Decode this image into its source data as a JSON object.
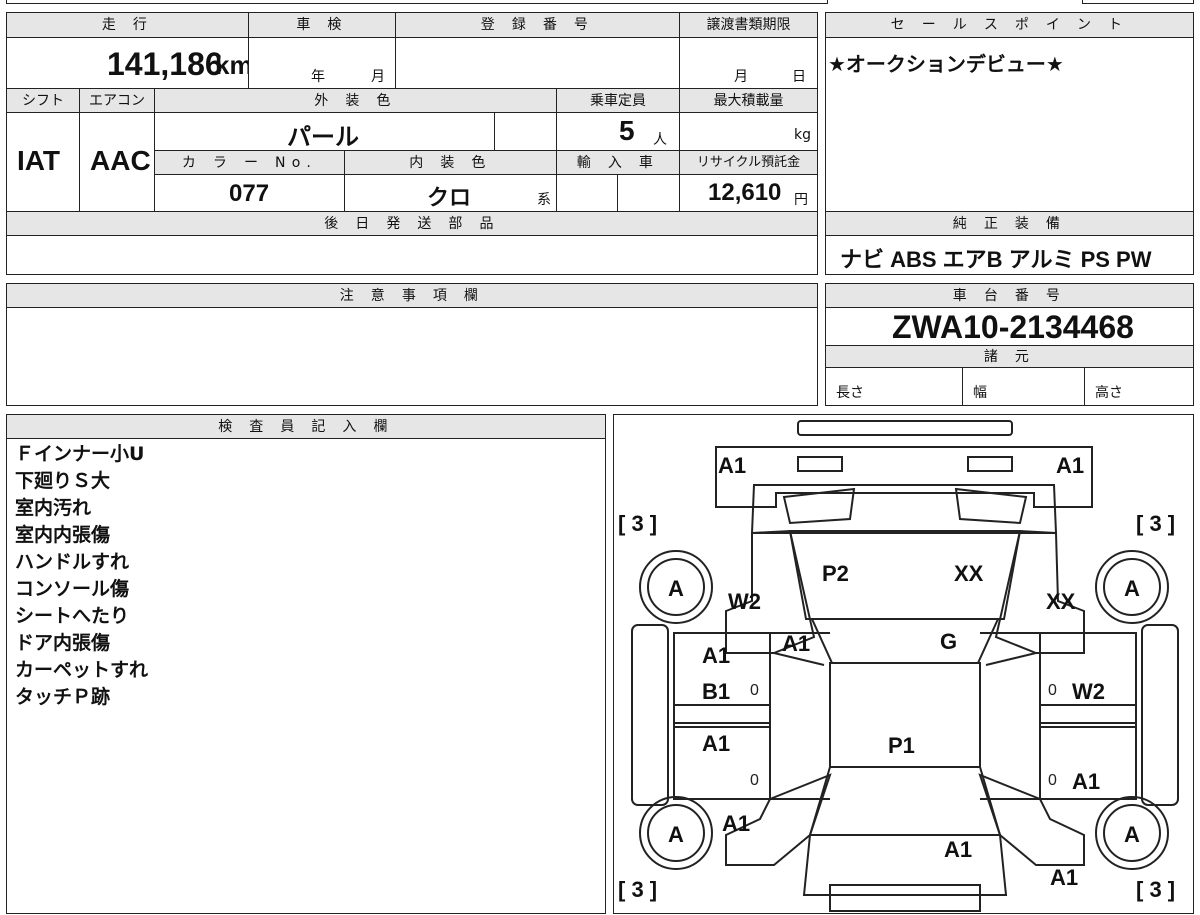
{
  "header_labels": {
    "mileage": "走 行",
    "inspection": "車 検",
    "registration": "登 録 番 号",
    "transfer_deadline": "譲渡書類期限",
    "shift": "シフト",
    "aircon": "エアコン",
    "exterior_color": "外 装 色",
    "capacity": "乗車定員",
    "max_load": "最大積載量",
    "color_no": "カ ラ ー No.",
    "interior_color": "内 装 色",
    "import": "輸 入 車",
    "recycle": "リサイクル預託金",
    "later_parts": "後 日 発 送 部 品",
    "notes": "注 意 事 項 欄",
    "sales_point": "セ ー ル ス ポ イ ン ト",
    "equipment": "純 正 装 備",
    "chassis": "車 台 番 号",
    "specs": "諸 元",
    "inspector": "検 査 員 記 入 欄"
  },
  "values": {
    "mileage": "141,186",
    "mileage_unit": "km",
    "year_unit": "年",
    "month_unit": "月",
    "transfer_month": "月",
    "transfer_day": "日",
    "shift": "IAT",
    "aircon": "AAC",
    "exterior_color": "パール",
    "capacity": "5",
    "capacity_unit": "人",
    "load_unit": "kg",
    "color_no": "077",
    "interior_color": "クロ",
    "interior_suffix": "系",
    "recycle": "12,610",
    "recycle_unit": "円"
  },
  "sales_point": "★オークションデビュー★",
  "equipment": "ナビ ABS エアB アルミ PS PW",
  "chassis": "ZWA10-2134468",
  "specs": {
    "length": "長さ",
    "width": "幅",
    "height": "高さ"
  },
  "inspector_notes": [
    "Ｆインナー小U",
    "下廻りＳ大",
    "室内汚れ",
    "室内内張傷",
    "ハンドルすれ",
    "コンソール傷",
    "シートへたり",
    "ドア内張傷",
    "カーペットすれ",
    "タッチＰ跡"
  ],
  "diagram": {
    "front_left": "A1",
    "front_right": "A1",
    "tire_marks": [
      "[ 3 ]",
      "[ 3 ]",
      "[ 3 ]",
      "[ 3 ]"
    ],
    "wheels": [
      "A",
      "A",
      "A",
      "A"
    ],
    "hood_left": "P2",
    "hood_right": "XX",
    "w2_left": "W2",
    "xx_right": "XX",
    "a1_pillar": "A1",
    "windshield": "G",
    "door_fl_1": "A1",
    "door_fl_2": "B1",
    "door_fr": "W2",
    "roof": "P1",
    "door_rl": "A1",
    "door_rr": "A1",
    "rear_left": "A1",
    "rear_center": "A1",
    "rear_right": "A1",
    "zeros": [
      "0",
      "0",
      "0",
      "0"
    ]
  }
}
